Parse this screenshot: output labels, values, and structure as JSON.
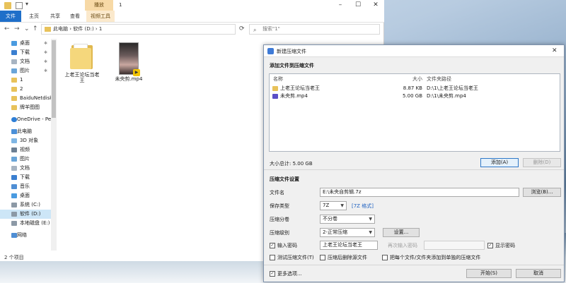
{
  "explorer": {
    "title": "1",
    "contextual_tab": "播放",
    "ribbon_tabs": [
      "文件",
      "主页",
      "共享",
      "查看",
      "视频工具"
    ],
    "address_path": "此电脑 › 软件 (D:) › 1",
    "search_placeholder": "搜索\"1\"",
    "nav_items": [
      "桌面",
      "下载",
      "文档",
      "图片",
      "1",
      "2",
      "BaiduNetdisk",
      "牌羊图图",
      "OneDrive - Per",
      "此电脑",
      "3D 对象",
      "视频",
      "图片",
      "文档",
      "下载",
      "音乐",
      "桌面",
      "系统 (C:)",
      "软件 (D:)",
      "本地磁盘 (E:)",
      "网络"
    ],
    "files": [
      {
        "name": "上老王论坛当老王",
        "type": "folder"
      },
      {
        "name": "未央剪.mp4",
        "type": "video"
      }
    ],
    "status": "2 个项目"
  },
  "dialog": {
    "title": "新建压缩文件",
    "section_add": "添加文件到压缩文件",
    "columns": {
      "name": "名称",
      "size": "大小",
      "path": "文件夹路径"
    },
    "rows": [
      {
        "name": "上老王论坛当老王",
        "size": "8.87 KB",
        "path": "D:\\1\\上老王论坛当老王"
      },
      {
        "name": "未央剪.mp4",
        "size": "5.00 GB",
        "path": "D:\\1\\未央剪.mp4"
      }
    ],
    "total_size": "大小总计: 5.00 GB",
    "add_button": "添加(A)",
    "delete_button": "删除(D)",
    "section_settings": "压缩文件设置",
    "filename_label": "文件名",
    "filename_value": "E:\\未央自剪辑.7z",
    "browse_button": "浏览(B)...",
    "save_type_label": "保存类型",
    "save_type_value": "7Z",
    "format_link": "[7Z 格式]",
    "split_label": "压缩分卷",
    "split_value": "不分卷",
    "level_label": "压缩级别",
    "level_value": "2-正常压缩",
    "settings_button": "设置...",
    "password_label": "输入密码",
    "password_value": "上老王论坛当老王",
    "reenter_label": "再次输入密码",
    "show_password_label": "显示密码",
    "test_label": "测试压缩文件(T)",
    "delete_src_label": "压缩后删除源文件",
    "each_file_label": "把每个文件/文件夹添加到单独的压缩文件",
    "more_options_label": "更多选项...",
    "start_button": "开始(S)",
    "cancel_button": "取消"
  }
}
